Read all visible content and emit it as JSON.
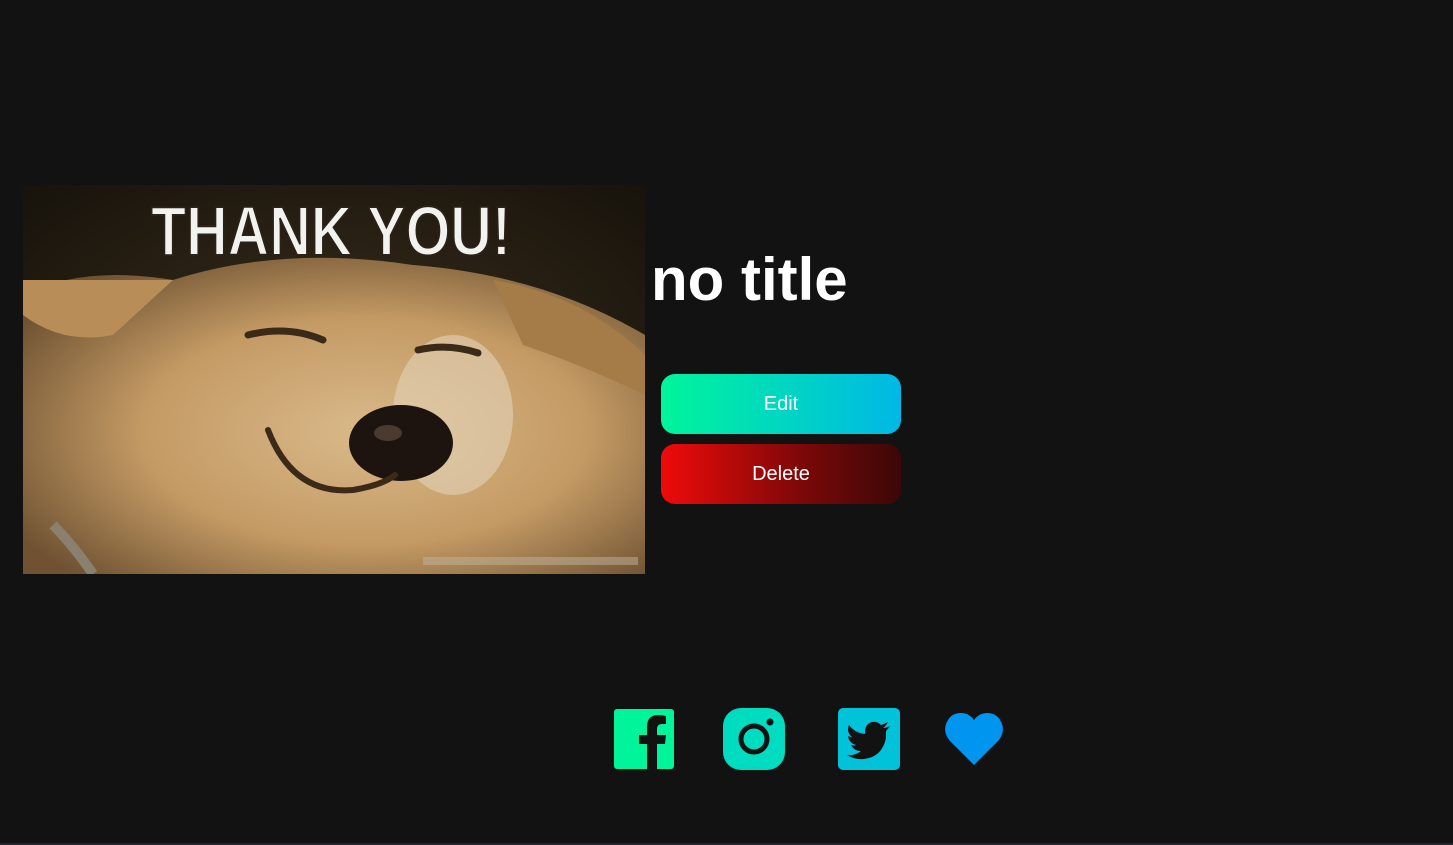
{
  "post": {
    "title": "no title",
    "image_caption": "THANK YOU!"
  },
  "actions": {
    "edit_label": "Edit",
    "delete_label": "Delete"
  },
  "social": [
    {
      "icon": "facebook-icon",
      "color": "#00f59b"
    },
    {
      "icon": "instagram-icon",
      "color": "#00dcc0"
    },
    {
      "icon": "twitter-icon",
      "color": "#00c2d8"
    },
    {
      "icon": "heart-icon",
      "color": "#0096f0"
    }
  ],
  "colors": {
    "background": "#121212",
    "edit_gradient": [
      "#00f59b",
      "#00b8e6"
    ],
    "delete_gradient": [
      "#f00a0a",
      "#3c0707"
    ]
  }
}
